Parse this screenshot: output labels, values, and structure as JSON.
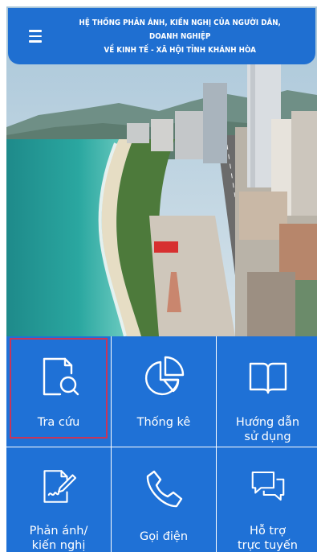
{
  "header": {
    "title_line1": "HỆ THỐNG PHẢN ÁNH, KIẾN NGHỊ CỦA NGƯỜI DÂN, DOANH NGHIỆP",
    "title_line2": "VỀ KINH TẾ - XÃ HỘI TỈNH KHÁNH HÒA",
    "menu_icon": "hamburger-menu-icon",
    "color": "#1f6fd1"
  },
  "tiles": [
    {
      "label": "Tra cứu",
      "icon": "document-search-icon",
      "active": true
    },
    {
      "label": "Thống kê",
      "icon": "pie-chart-icon",
      "active": false
    },
    {
      "label": "Hướng dẫn\nsử dụng",
      "icon": "book-icon",
      "active": false
    },
    {
      "label": "Phản ánh/\nkiến nghị",
      "icon": "document-edit-icon",
      "active": false
    },
    {
      "label": "Gọi điện",
      "icon": "phone-icon",
      "active": false
    },
    {
      "label": "Hỗ trợ\ntrực tuyến",
      "icon": "chat-bubbles-icon",
      "active": false
    }
  ],
  "colors": {
    "tile": "#1f71d6",
    "active_border": "#c7355a"
  }
}
